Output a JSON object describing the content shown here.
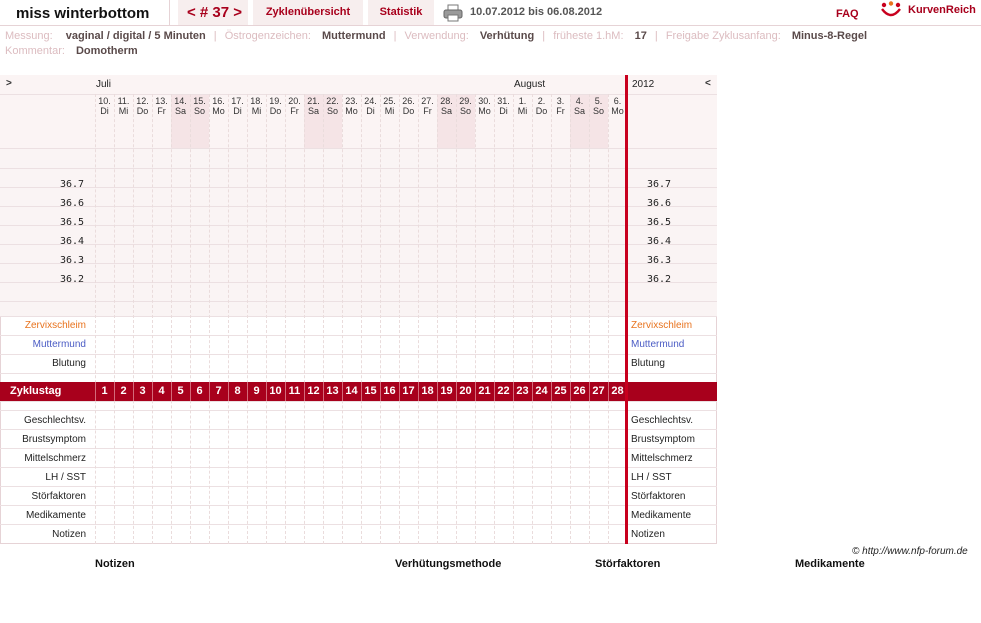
{
  "header": {
    "user_name": "miss winterbottom",
    "cycle_nav": "< # 37 >",
    "tab_overview": "Zyklenübersicht",
    "tab_stats": "Statistik",
    "date_range": "10.07.2012 bis 06.08.2012",
    "faq": "FAQ",
    "logo_text": "KurvenReich",
    "print_icon": "printer-icon",
    "logo_icon": "kurvenreich-logo-icon"
  },
  "info": {
    "messung_label": "Messung:",
    "messung_value": "vaginal / digital / 5 Minuten",
    "oestrogen_label": "Östrogenzeichen:",
    "oestrogen_value": "Muttermund",
    "verwendung_label": "Verwendung:",
    "verwendung_value": "Verhütung",
    "hm_label": "früheste 1.hM:",
    "hm_value": "17",
    "freigabe_label": "Freigabe Zyklusanfang:",
    "freigabe_value": "Minus-8-Regel",
    "kommentar_label": "Kommentar:",
    "kommentar_value": "Domotherm"
  },
  "chart": {
    "nav_left": ">",
    "nav_right": "<",
    "month_july": "Juli",
    "month_august": "August",
    "year": "2012",
    "days": [
      {
        "num": "10.",
        "wd": "Di"
      },
      {
        "num": "11.",
        "wd": "Mi"
      },
      {
        "num": "12.",
        "wd": "Do"
      },
      {
        "num": "13.",
        "wd": "Fr"
      },
      {
        "num": "14.",
        "wd": "Sa"
      },
      {
        "num": "15.",
        "wd": "So"
      },
      {
        "num": "16.",
        "wd": "Mo"
      },
      {
        "num": "17.",
        "wd": "Di"
      },
      {
        "num": "18.",
        "wd": "Mi"
      },
      {
        "num": "19.",
        "wd": "Do"
      },
      {
        "num": "20.",
        "wd": "Fr"
      },
      {
        "num": "21.",
        "wd": "Sa"
      },
      {
        "num": "22.",
        "wd": "So"
      },
      {
        "num": "23.",
        "wd": "Mo"
      },
      {
        "num": "24.",
        "wd": "Di"
      },
      {
        "num": "25.",
        "wd": "Mi"
      },
      {
        "num": "26.",
        "wd": "Do"
      },
      {
        "num": "27.",
        "wd": "Fr"
      },
      {
        "num": "28.",
        "wd": "Sa"
      },
      {
        "num": "29.",
        "wd": "So"
      },
      {
        "num": "30.",
        "wd": "Mo"
      },
      {
        "num": "31.",
        "wd": "Di"
      },
      {
        "num": "1.",
        "wd": "Mi"
      },
      {
        "num": "2.",
        "wd": "Do"
      },
      {
        "num": "3.",
        "wd": "Fr"
      },
      {
        "num": "4.",
        "wd": "Sa"
      },
      {
        "num": "5.",
        "wd": "So"
      },
      {
        "num": "6.",
        "wd": "Mo"
      }
    ],
    "temps": [
      "36.7",
      "36.6",
      "36.5",
      "36.4",
      "36.3",
      "36.2"
    ],
    "row_zervix": "Zervixschleim",
    "row_muttermund": "Muttermund",
    "row_blutung": "Blutung",
    "cycle_label": "Zyklustag",
    "cycle_days": [
      "1",
      "2",
      "3",
      "4",
      "5",
      "6",
      "7",
      "8",
      "9",
      "10",
      "11",
      "12",
      "13",
      "14",
      "15",
      "16",
      "17",
      "18",
      "19",
      "20",
      "21",
      "22",
      "23",
      "24",
      "25",
      "26",
      "27",
      "28"
    ],
    "bottom_rows": [
      "Geschlechtsv.",
      "Brustsymptom",
      "Mittelschmerz",
      "LH / SST",
      "Störfaktoren",
      "Medikamente",
      "Notizen"
    ]
  },
  "footer": {
    "copyright": "© http://www.nfp-forum.de",
    "legend_notizen": "Notizen",
    "legend_verhuetung": "Verhütungsmethode",
    "legend_stoerfaktoren": "Störfaktoren",
    "legend_medikamente": "Medikamente"
  },
  "colors": {
    "accent": "#a8001c",
    "cycle_line": "#c8001e",
    "zervix": "#e8731e",
    "muttermund": "#4a5bc4"
  }
}
